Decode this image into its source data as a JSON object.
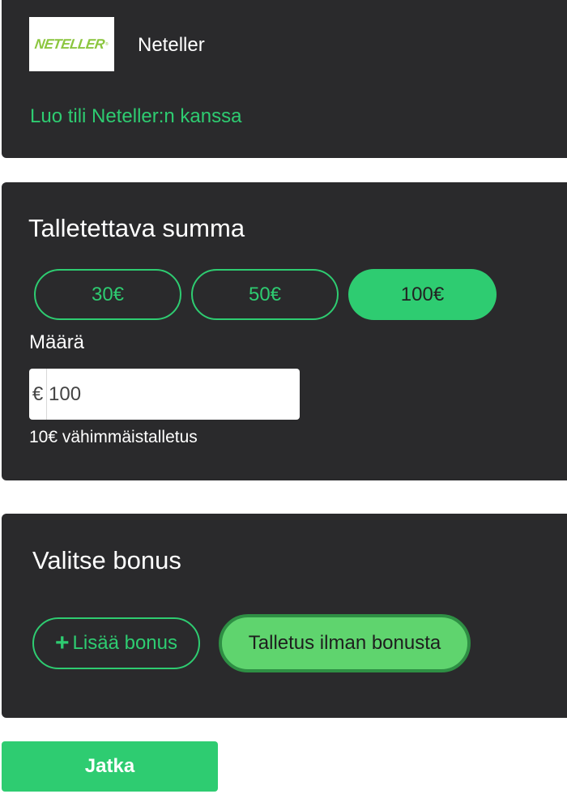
{
  "provider": {
    "logo_text": "NETELLER",
    "logo_mark": "®",
    "name": "Neteller",
    "create_account_link": "Luo tili Neteller:n kanssa"
  },
  "deposit": {
    "title": "Talletettava summa",
    "presets": [
      "30€",
      "50€",
      "100€"
    ],
    "selected_preset": "100€",
    "amount_label": "Määrä",
    "currency_symbol": "€",
    "amount_value": "100",
    "minimum_note": "10€ vähimmäistalletus"
  },
  "bonus": {
    "title": "Valitse bonus",
    "add_icon": "+",
    "add_label": "Lisää bonus",
    "no_bonus_label": "Talletus ilman bonusta",
    "selected": "no_bonus"
  },
  "footer": {
    "continue_label": "Jatka"
  },
  "colors": {
    "accent": "#2ecc71",
    "panel": "#2a2a2c",
    "selected_bonus": "#5fd46e"
  }
}
